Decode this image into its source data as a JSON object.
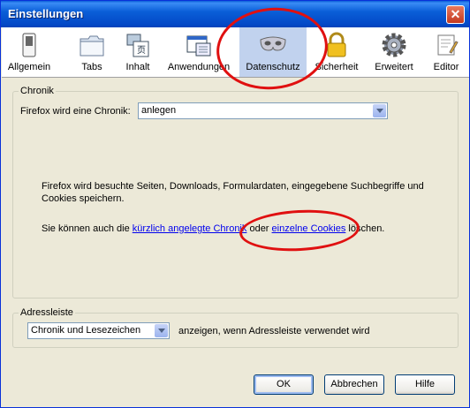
{
  "window": {
    "title": "Einstellungen",
    "close_glyph": "✕"
  },
  "toolbar": {
    "items": [
      {
        "label": "Allgemein",
        "icon": "switch-icon"
      },
      {
        "label": "Tabs",
        "icon": "folder-tabs-icon"
      },
      {
        "label": "Inhalt",
        "icon": "content-icon"
      },
      {
        "label": "Anwendungen",
        "icon": "applications-icon"
      },
      {
        "label": "Datenschutz",
        "icon": "mask-icon",
        "selected": true
      },
      {
        "label": "Sicherheit",
        "icon": "lock-icon"
      },
      {
        "label": "Erweitert",
        "icon": "gear-icon"
      },
      {
        "label": "Editor",
        "icon": "editor-icon"
      }
    ]
  },
  "history": {
    "group_title": "Chronik",
    "label": "Firefox wird eine Chronik:",
    "selected": "anlegen",
    "description": "Firefox wird besuchte Seiten, Downloads, Formulardaten, eingegebene Suchbegriffe und",
    "description2": "Cookies speichern.",
    "links_prefix": "Sie können auch die",
    "link_history": "kürzlich angelegte Chronik",
    "links_middle": "oder",
    "link_cookies": "einzelne Cookies",
    "links_suffix": "löschen."
  },
  "addressbar": {
    "group_title": "Adressleiste",
    "selected": "Chronik und Lesezeichen",
    "suffix": "anzeigen, wenn Adressleiste verwendet wird"
  },
  "buttons": {
    "ok": "OK",
    "cancel": "Abbrechen",
    "help": "Hilfe"
  },
  "colors": {
    "annotation": "#e01010",
    "selected_tab": "#c1d2ee",
    "titlebar": "#0a5fd8"
  }
}
